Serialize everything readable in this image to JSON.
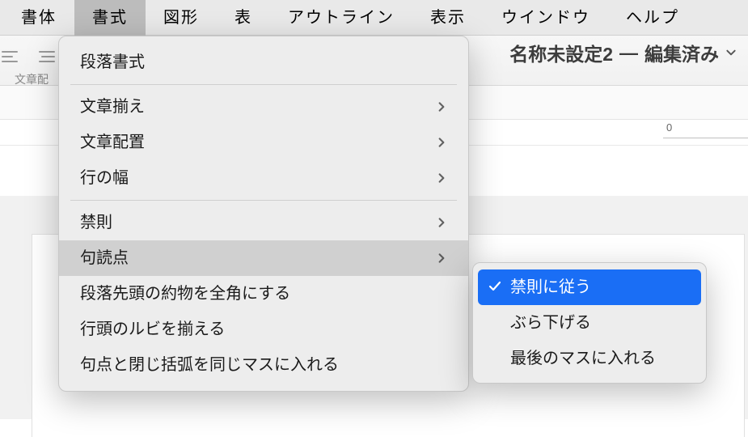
{
  "menubar": {
    "items": [
      "書体",
      "書式",
      "図形",
      "表",
      "アウトライン",
      "表示",
      "ウインドウ",
      "ヘルプ"
    ],
    "activeIndex": 1
  },
  "document": {
    "title_a": "名称未設定2",
    "title_sep": "—",
    "title_b": "編集済み"
  },
  "toolbar": {
    "label": "文章配"
  },
  "ruler": {
    "tick0": "0"
  },
  "dropdown": {
    "title": "書式",
    "groups": [
      {
        "items": [
          {
            "label": "段落書式",
            "hasSub": false
          }
        ]
      },
      {
        "items": [
          {
            "label": "文章揃え",
            "hasSub": true
          },
          {
            "label": "文章配置",
            "hasSub": true
          },
          {
            "label": "行の幅",
            "hasSub": true
          }
        ]
      },
      {
        "items": [
          {
            "label": "禁則",
            "hasSub": true
          },
          {
            "label": "句読点",
            "hasSub": true,
            "hovered": true
          },
          {
            "label": "段落先頭の約物を全角にする",
            "hasSub": false
          },
          {
            "label": "行頭のルビを揃える",
            "hasSub": false
          },
          {
            "label": "句点と閉じ括弧を同じマスに入れる",
            "hasSub": false
          }
        ]
      }
    ]
  },
  "submenu": {
    "items": [
      {
        "label": "禁則に従う",
        "selected": true
      },
      {
        "label": "ぶら下げる",
        "selected": false
      },
      {
        "label": "最後のマスに入れる",
        "selected": false
      }
    ]
  }
}
